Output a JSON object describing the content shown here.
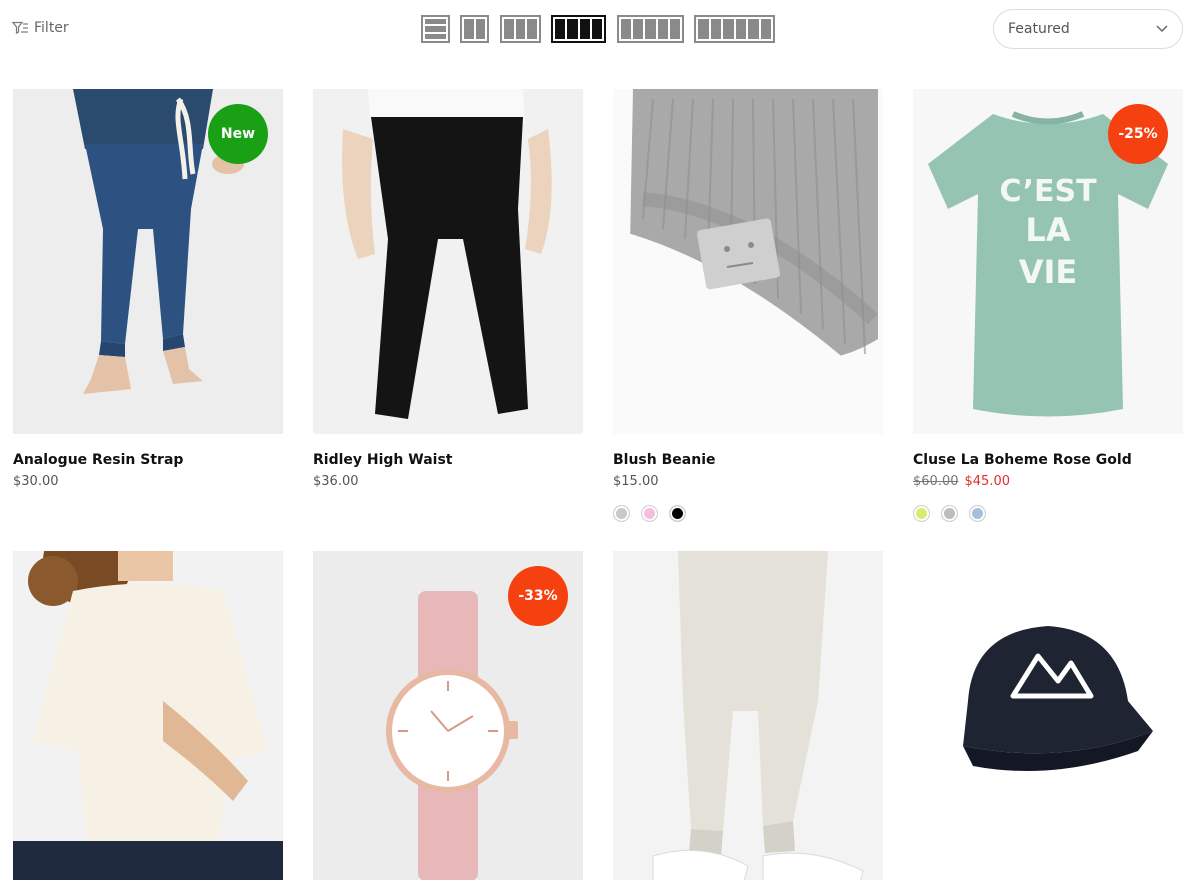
{
  "toolbar": {
    "filter_label": "Filter",
    "sort_value": "Featured",
    "grid_options": [
      "list",
      "2-columns",
      "3-columns",
      "4-columns",
      "5-columns",
      "6-columns"
    ],
    "grid_selected": "4-columns"
  },
  "products": [
    {
      "title": "Analogue Resin Strap",
      "price": "$30.00",
      "badge": "New"
    },
    {
      "title": "Ridley High Waist",
      "price": "$36.00"
    },
    {
      "title": "Blush Beanie",
      "price": "$15.00",
      "swatches": [
        "#c9c9c9",
        "#f7bde0",
        "#000000"
      ]
    },
    {
      "title": "Cluse La Boheme Rose Gold",
      "old_price": "$60.00",
      "price": "$45.00",
      "badge": "-25%",
      "swatches": [
        "#d9ea6f",
        "#bdbdbd",
        "#a7bfdf"
      ]
    },
    {
      "title": "",
      "price": ""
    },
    {
      "title": "",
      "price": "",
      "badge": "-33%"
    },
    {
      "title": "",
      "price": ""
    },
    {
      "title": "",
      "price": ""
    }
  ],
  "colors": {
    "new_badge": "#1aa014",
    "sale_badge": "#f5410f",
    "sale_price": "#e12e2e"
  }
}
